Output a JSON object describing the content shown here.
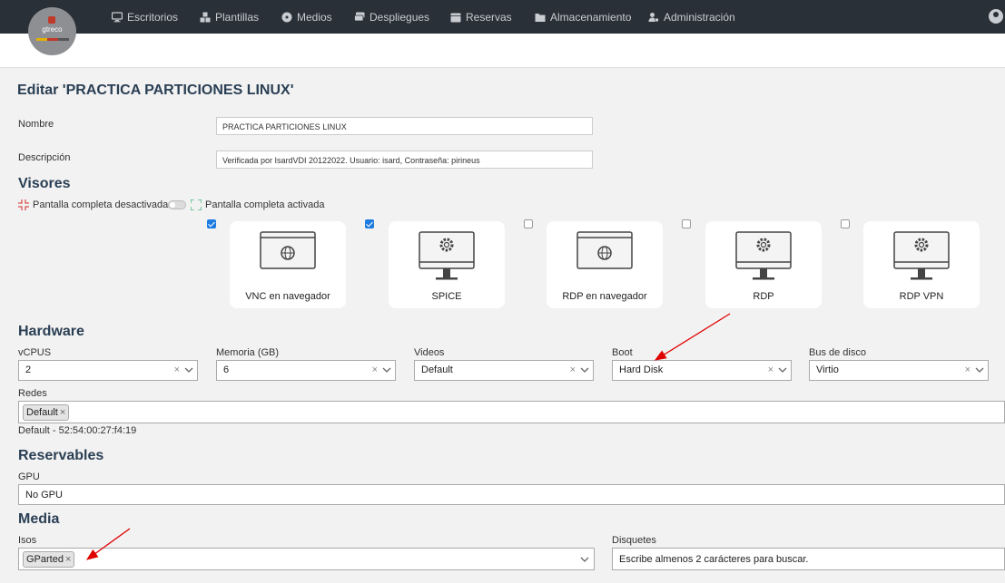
{
  "nav": {
    "items": [
      {
        "label": "Escritorios",
        "icon": "desktop-icon"
      },
      {
        "label": "Plantillas",
        "icon": "cubes-icon"
      },
      {
        "label": "Medios",
        "icon": "disc-icon"
      },
      {
        "label": "Despliegues",
        "icon": "tv-stack-icon"
      },
      {
        "label": "Reservas",
        "icon": "calendar-icon"
      },
      {
        "label": "Almacenamiento",
        "icon": "folder-icon"
      },
      {
        "label": "Administración",
        "icon": "user-gear-icon"
      }
    ],
    "logo_text": "gtreco"
  },
  "page": {
    "title": "Editar 'PRACTICA PARTICIONES LINUX'"
  },
  "form": {
    "nombre_label": "Nombre",
    "nombre_value": "PRACTICA PARTICIONES LINUX",
    "descripcion_label": "Descripción",
    "descripcion_value": "Verificada por IsardVDI 20122022. Usuario: isard, Contraseña: pirineus"
  },
  "visores": {
    "heading": "Visores",
    "fullscreen_off": "Pantalla completa desactivada",
    "fullscreen_on": "Pantalla completa activada",
    "viewers": [
      {
        "label": "VNC en navegador",
        "checked": true,
        "icon": "browser-globe-icon"
      },
      {
        "label": "SPICE",
        "checked": true,
        "icon": "monitor-gear-icon"
      },
      {
        "label": "RDP en navegador",
        "checked": false,
        "icon": "browser-globe-icon"
      },
      {
        "label": "RDP",
        "checked": false,
        "icon": "monitor-gear-icon"
      },
      {
        "label": "RDP VPN",
        "checked": false,
        "icon": "monitor-gear-icon"
      }
    ]
  },
  "hardware": {
    "heading": "Hardware",
    "vcpus_label": "vCPUS",
    "vcpus_value": "2",
    "memoria_label": "Memoria (GB)",
    "memoria_value": "6",
    "videos_label": "Videos",
    "videos_value": "Default",
    "boot_label": "Boot",
    "boot_value": "Hard Disk",
    "bus_label": "Bus de disco",
    "bus_value": "Virtio",
    "redes_label": "Redes",
    "redes_tag": "Default",
    "redes_mac": "Default - 52:54:00:27:f4:19"
  },
  "reservables": {
    "heading": "Reservables",
    "gpu_label": "GPU",
    "gpu_value": "No GPU"
  },
  "media": {
    "heading": "Media",
    "isos_label": "Isos",
    "isos_tag": "GParted",
    "disquetes_label": "Disquetes",
    "disquetes_placeholder": "Escribe almenos 2 carácteres para buscar."
  },
  "colors": {
    "topbar": "#2a3038",
    "heading": "#2a3f54",
    "checkbox_on": "#1e7be0",
    "annotation_arrow": "#e00000"
  }
}
